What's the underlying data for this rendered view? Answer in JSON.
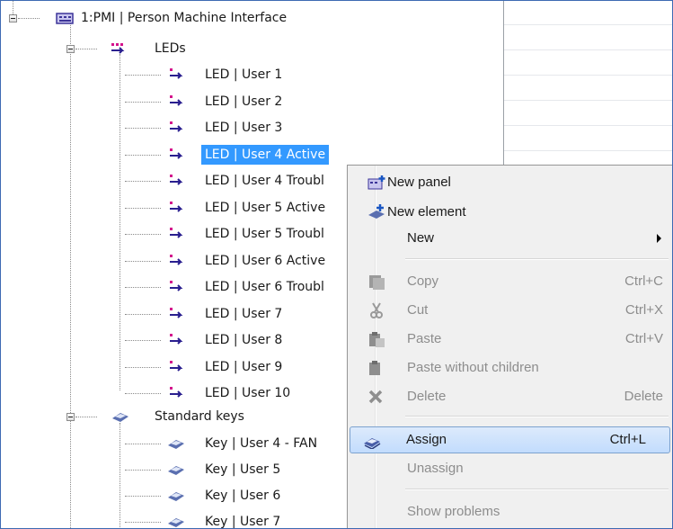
{
  "tree": {
    "root": {
      "label": "1:PMI | Person Machine Interface",
      "icon": "panel-icon"
    },
    "leds_group": {
      "label": "LEDs",
      "icon": "led-group-icon"
    },
    "leds": [
      {
        "label": "LED | User 1"
      },
      {
        "label": "LED | User 2"
      },
      {
        "label": "LED | User 3"
      },
      {
        "label": "LED | User 4 Active"
      },
      {
        "label": "LED | User 4 Troubl"
      },
      {
        "label": "LED | User 5 Active"
      },
      {
        "label": "LED | User 5 Troubl"
      },
      {
        "label": "LED | User 6 Active"
      },
      {
        "label": "LED | User 6 Troubl"
      },
      {
        "label": "LED | User 7"
      },
      {
        "label": "LED | User 8"
      },
      {
        "label": "LED | User 9"
      },
      {
        "label": "LED | User 10"
      }
    ],
    "keys_group": {
      "label": "Standard keys",
      "icon": "key-group-icon"
    },
    "keys": [
      {
        "label": "Key | User 4 - FAN"
      },
      {
        "label": "Key | User 5"
      },
      {
        "label": "Key | User 6"
      },
      {
        "label": "Key | User 7"
      }
    ],
    "selected_index": 3
  },
  "context_menu": {
    "new_panel": "New panel",
    "new_element": "New element",
    "new": "New",
    "copy": "Copy",
    "copy_shortcut": "Ctrl+C",
    "cut": "Cut",
    "cut_shortcut": "Ctrl+X",
    "paste": "Paste",
    "paste_shortcut": "Ctrl+V",
    "paste_without_children": "Paste without children",
    "delete": "Delete",
    "delete_shortcut": "Delete",
    "assign": "Assign",
    "assign_shortcut": "Ctrl+L",
    "unassign": "Unassign",
    "show_problems": "Show problems"
  },
  "colors": {
    "selection": "#3399ff",
    "menu_hover": "#c2dcfd",
    "arrow_magenta": "#d4148c",
    "arrow_navy": "#2a1f8f"
  }
}
